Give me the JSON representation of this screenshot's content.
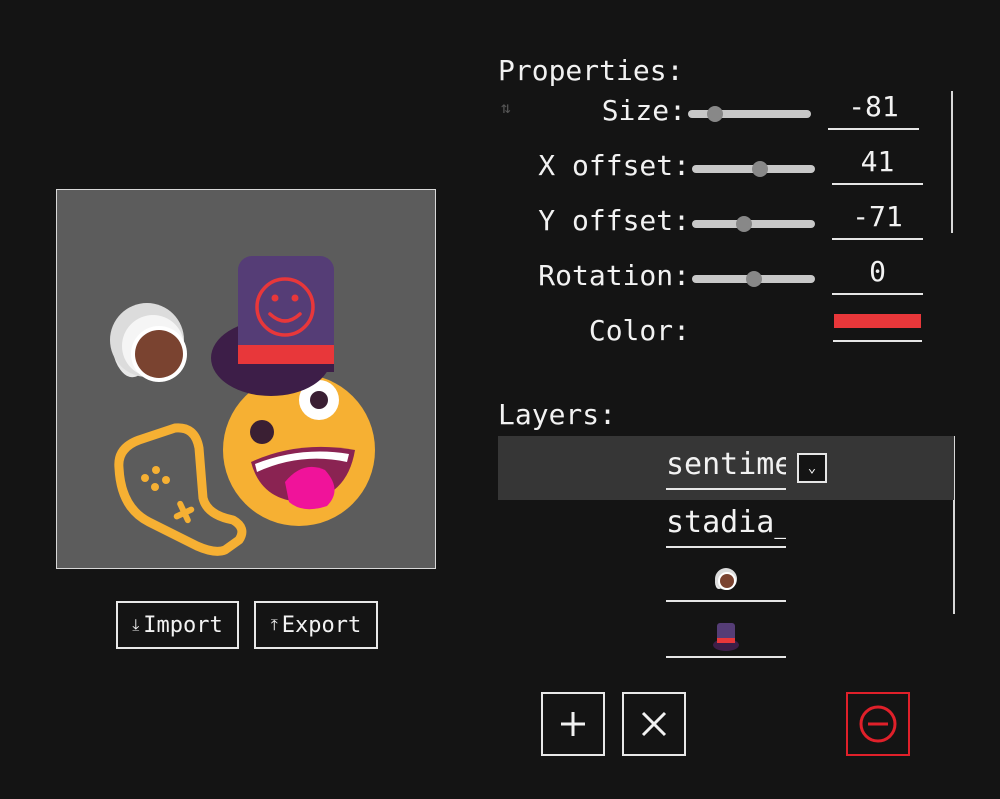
{
  "canvas": {
    "background": "#5c5c5c"
  },
  "file_buttons": {
    "import_label": "Import",
    "import_icon": "download-icon",
    "export_label": "Export",
    "export_icon": "upload-icon"
  },
  "properties": {
    "heading": "Properties:",
    "size": {
      "label": "Size:",
      "value": "-81",
      "slider_level": 0.22
    },
    "x_offset": {
      "label": "X offset:",
      "value": "41",
      "slider_level": 0.55
    },
    "y_offset": {
      "label": "Y offset:",
      "value": "-71",
      "slider_level": 0.42
    },
    "rotation": {
      "label": "Rotation:",
      "value": "0",
      "slider_level": 0.5
    },
    "color": {
      "label": "Color:",
      "value": "#e8373a"
    }
  },
  "layers": {
    "heading": "Layers:",
    "items": [
      {
        "name": "sentime",
        "selected": true
      },
      {
        "name": "stadia_",
        "selected": false
      },
      {
        "name": "",
        "icon": "coffee-cup-icon",
        "selected": false
      },
      {
        "name": "",
        "icon": "top-hat-icon",
        "selected": false
      }
    ]
  },
  "toolbar": {
    "add_icon": "plus-icon",
    "delete_icon": "x-icon",
    "remove_icon": "minus-circle-icon",
    "danger_color": "#e0202a"
  }
}
